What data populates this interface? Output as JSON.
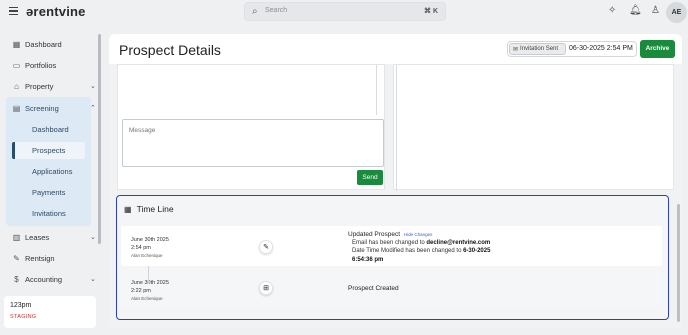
{
  "app": {
    "logo": "ərentvine"
  },
  "search": {
    "placeholder": "Search",
    "shortcut": "⌘ K"
  },
  "user": {
    "initials": "AE"
  },
  "sidebar": {
    "items": [
      {
        "label": "Dashboard",
        "icon": "dashboard-icon"
      },
      {
        "label": "Portfolios",
        "icon": "folder-icon"
      },
      {
        "label": "Property",
        "icon": "building-icon"
      },
      {
        "label": "Screening",
        "icon": "document-icon"
      },
      {
        "label": "Leases",
        "icon": "lease-icon"
      },
      {
        "label": "Rentsign",
        "icon": "signature-icon"
      },
      {
        "label": "Accounting",
        "icon": "dollar-icon"
      }
    ],
    "screening_sub": [
      "Dashboard",
      "Prospects",
      "Applications",
      "Payments",
      "Invitations"
    ],
    "active_sub": "Prospects"
  },
  "environment": {
    "name": "123pm",
    "tag": "STAGING"
  },
  "page": {
    "title": "Prospect Details",
    "invitation_badge": "Invitation Sent",
    "invitation_date": "06-30-2025 2:54 PM",
    "archive_label": "Archive"
  },
  "message": {
    "placeholder": "Message",
    "send_label": "Send"
  },
  "timeline": {
    "title": "Time Line",
    "events": [
      {
        "date": "June 30th 2025",
        "time": "2:54 pm",
        "user": "Alan Echenique",
        "icon": "pencil-icon",
        "title": "Updated Prospect",
        "link": "Hide Changes",
        "change1_prefix": "Email has been changed to ",
        "change1_value": "decline@rentvine.com",
        "change2_prefix": "Date Time Modified has been changed to ",
        "change2_value": "6-30-2025 6:54:36 pm"
      },
      {
        "date": "June 30th 2025",
        "time": "2:22 pm",
        "user": "Alan Echenique",
        "icon": "plus-icon",
        "title": "Prospect Created"
      }
    ]
  },
  "colors": {
    "accent_green": "#1a8a3c",
    "highlight_blue": "#2a3fc4",
    "screening_bg": "#dde9f5"
  }
}
